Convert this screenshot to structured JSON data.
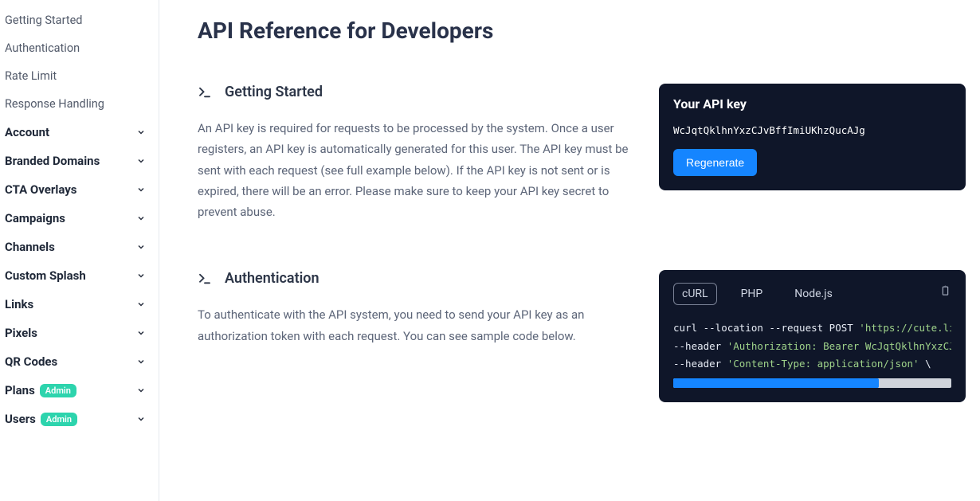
{
  "sidebar": {
    "plain": [
      "Getting Started",
      "Authentication",
      "Rate Limit",
      "Response Handling"
    ],
    "groups": [
      {
        "label": "Account"
      },
      {
        "label": "Branded Domains"
      },
      {
        "label": "CTA Overlays"
      },
      {
        "label": "Campaigns"
      },
      {
        "label": "Channels"
      },
      {
        "label": "Custom Splash"
      },
      {
        "label": "Links"
      },
      {
        "label": "Pixels"
      },
      {
        "label": "QR Codes"
      },
      {
        "label": "Plans",
        "badge": "Admin"
      },
      {
        "label": "Users",
        "badge": "Admin"
      }
    ]
  },
  "page_title": "API Reference for Developers",
  "section1": {
    "title": "Getting Started",
    "body": "An API key is required for requests to be processed by the system. Once a user registers, an API key is automatically generated for this user. The API key must be sent with each request (see full example below). If the API key is not sent or is expired, there will be an error. Please make sure to keep your API key secret to prevent abuse."
  },
  "api_card": {
    "title": "Your API key",
    "key": "WcJqtQklhnYxzCJvBffImiUKhzQucAJg",
    "regenerate": "Regenerate"
  },
  "section2": {
    "title": "Authentication",
    "body": "To authenticate with the API system, you need to send your API key as an authorization token with each request. You can see sample code below."
  },
  "code_card": {
    "tabs": [
      "cURL",
      "PHP",
      "Node.js"
    ],
    "active_tab": 0,
    "line1_a": "curl --location --request POST ",
    "line1_b": "'https://cute.link/a",
    "line2_a": "--header ",
    "line2_b": "'Authorization: Bearer WcJqtQklhnYxzCJvBff",
    "line3_a": "--header ",
    "line3_b": "'Content-Type: application/json'",
    "line3_c": " \\"
  }
}
